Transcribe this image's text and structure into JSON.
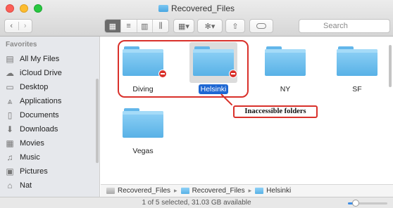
{
  "window": {
    "title": "Recovered_Files"
  },
  "toolbar": {
    "back": "‹",
    "forward": "›",
    "view_icons": [
      "▦",
      "≡",
      "▥",
      "⫼"
    ],
    "arrange": "▦▾",
    "action": "✻▾",
    "share": "⇧",
    "search_placeholder": "Search"
  },
  "sidebar": {
    "heading": "Favorites",
    "items": [
      {
        "label": "All My Files",
        "icon": "all-files-icon",
        "glyph": "▤"
      },
      {
        "label": "iCloud Drive",
        "icon": "cloud-icon",
        "glyph": "☁"
      },
      {
        "label": "Desktop",
        "icon": "desktop-icon",
        "glyph": "▭"
      },
      {
        "label": "Applications",
        "icon": "applications-icon",
        "glyph": "⩓"
      },
      {
        "label": "Documents",
        "icon": "documents-icon",
        "glyph": "▯"
      },
      {
        "label": "Downloads",
        "icon": "downloads-icon",
        "glyph": "⬇"
      },
      {
        "label": "Movies",
        "icon": "movies-icon",
        "glyph": "▦"
      },
      {
        "label": "Music",
        "icon": "music-icon",
        "glyph": "♫"
      },
      {
        "label": "Pictures",
        "icon": "pictures-icon",
        "glyph": "▣"
      },
      {
        "label": "Nat",
        "icon": "home-icon",
        "glyph": "⌂"
      }
    ]
  },
  "folders": [
    {
      "name": "Diving",
      "locked": true,
      "selected": false
    },
    {
      "name": "Helsinki",
      "locked": true,
      "selected": true
    },
    {
      "name": "NY",
      "locked": false,
      "selected": false
    },
    {
      "name": "SF",
      "locked": false,
      "selected": false
    },
    {
      "name": "Vegas",
      "locked": false,
      "selected": false
    }
  ],
  "annotation": {
    "callout": "Inaccessible folders",
    "color": "#d9312b"
  },
  "pathbar": {
    "segments": [
      "Recovered_Files",
      "Recovered_Files",
      "Helsinki"
    ]
  },
  "status": {
    "text": "1 of 5 selected, 31.03 GB available",
    "zoom_level": 0.2
  },
  "colors": {
    "selection": "#1e67d3",
    "folder": "#58b1e6",
    "alert": "#d9312b"
  }
}
